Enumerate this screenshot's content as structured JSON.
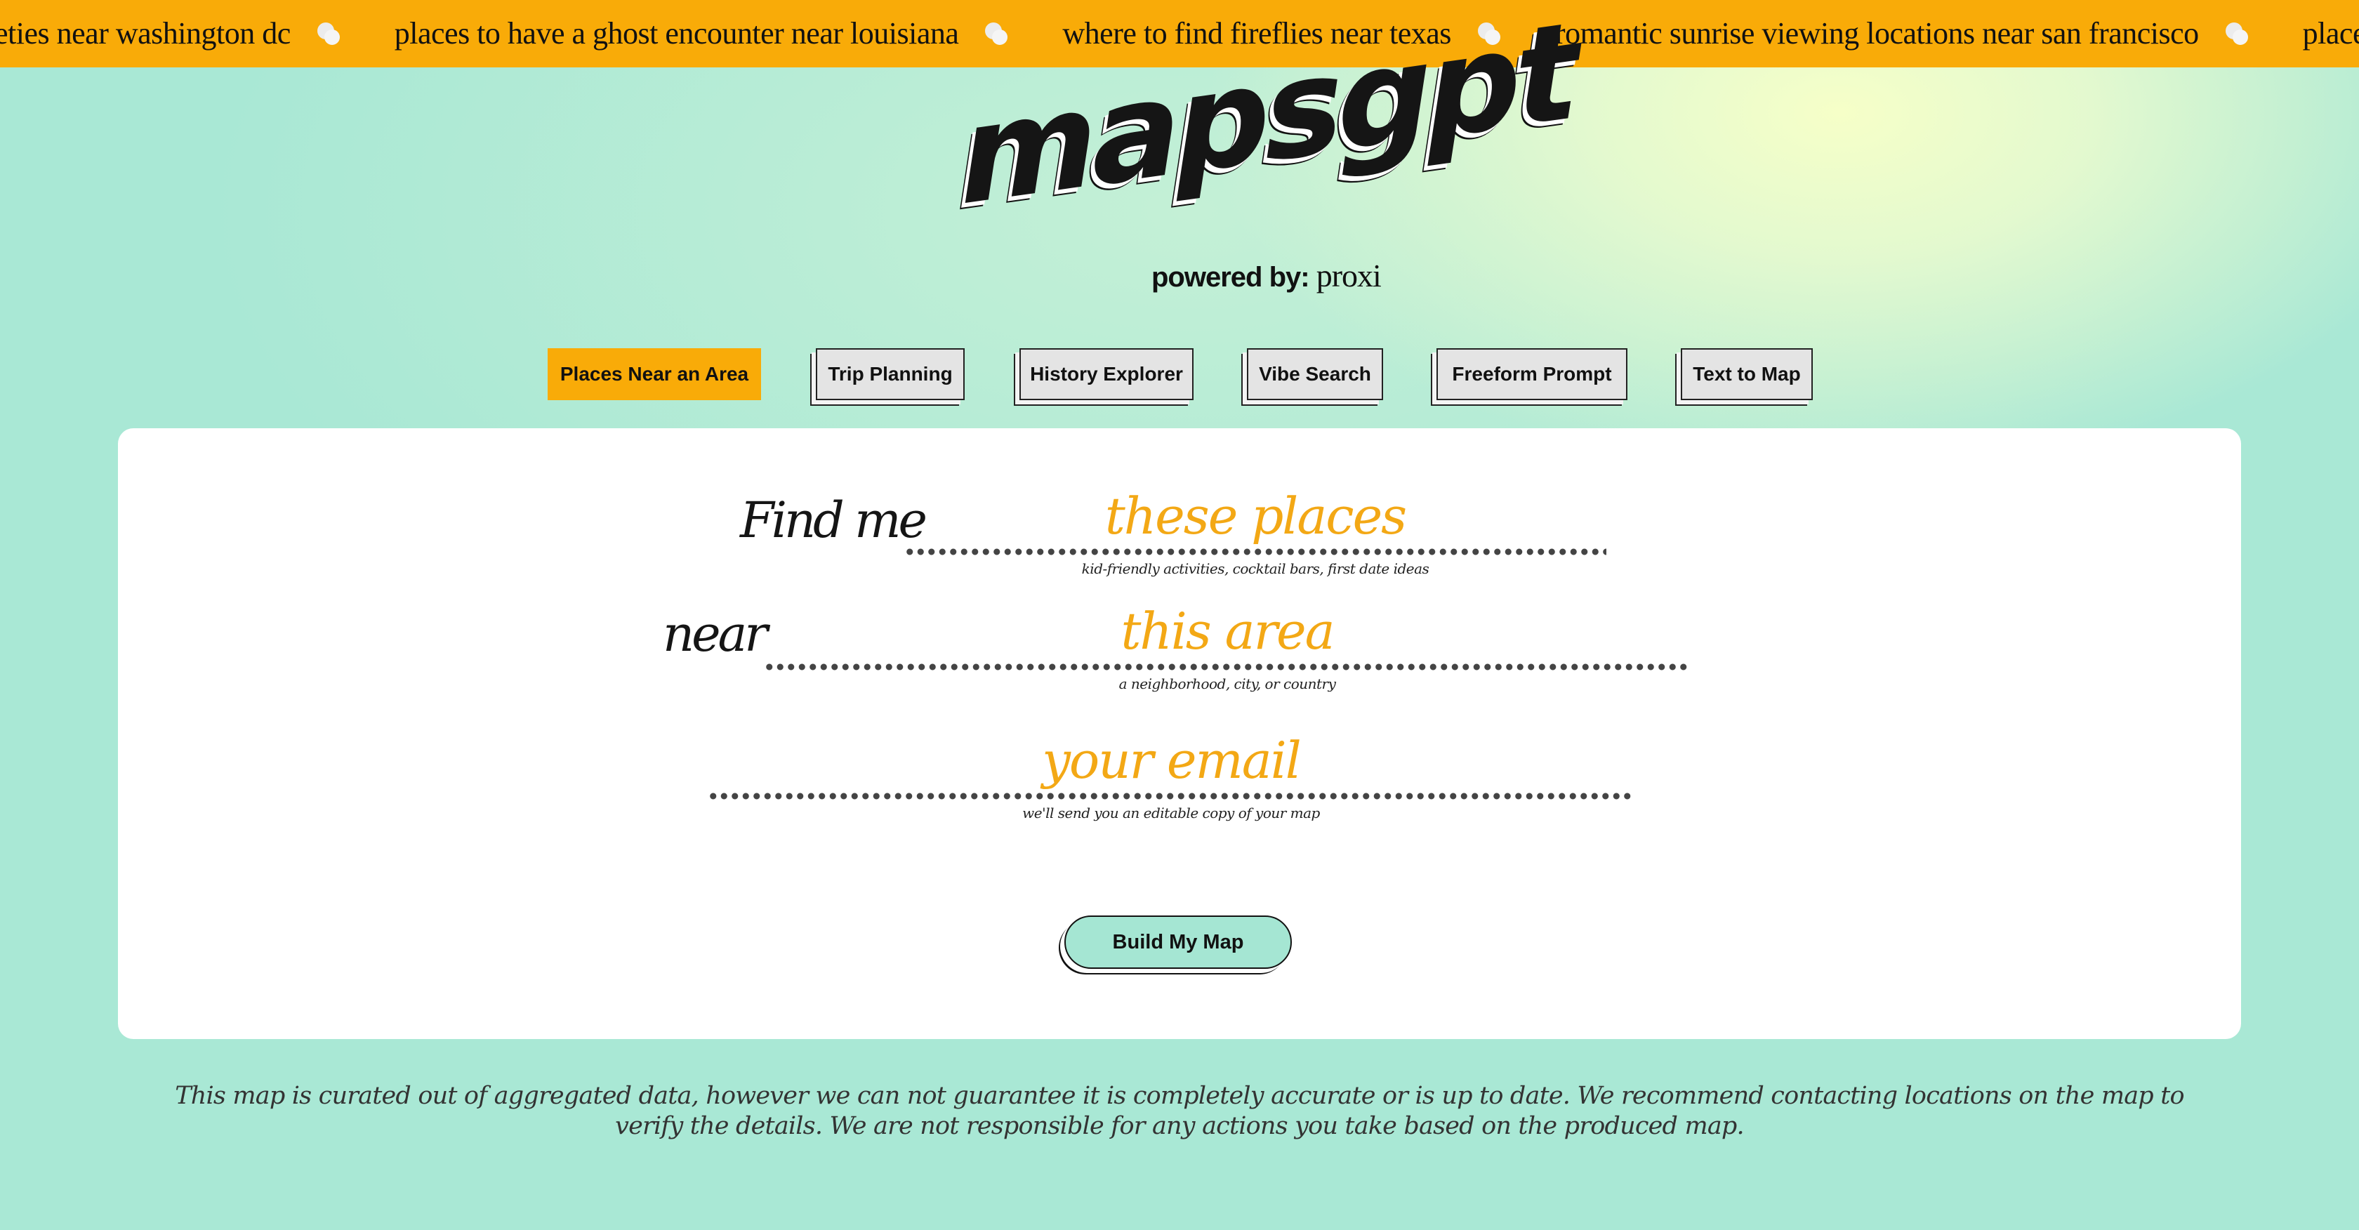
{
  "ticker": {
    "items": [
      "eties near washington dc",
      "places to have a ghost encounter near louisiana",
      "where to find fireflies near texas",
      "romantic sunrise viewing locations near san francisco",
      "places to get my creativ"
    ],
    "separator_icon": "moon-dots-icon"
  },
  "logo": {
    "wordmark": "mapsgpt",
    "powered_by": "powered by:",
    "brand": "proxi"
  },
  "tabs": [
    {
      "label": "Places Near an Area",
      "active": true
    },
    {
      "label": "Trip Planning",
      "active": false
    },
    {
      "label": "History Explorer",
      "active": false
    },
    {
      "label": "Vibe Search",
      "active": false
    },
    {
      "label": "Freeform Prompt",
      "active": false
    },
    {
      "label": "Text to Map",
      "active": false
    }
  ],
  "form": {
    "find_me": "Find me",
    "places": {
      "placeholder": "these places",
      "value": "",
      "hint": "kid-friendly activities, cocktail bars, first date ideas"
    },
    "near": "near",
    "area": {
      "placeholder": "this area",
      "value": "",
      "hint": "a neighborhood, city, or country"
    },
    "email": {
      "placeholder": "your email",
      "value": "",
      "hint": "we'll  send you an editable copy of your map"
    },
    "submit_label": "Build My Map"
  },
  "disclaimer": "This map is curated out of aggregated data, however we can not guarantee it is completely accurate or is up to date. We recommend contacting locations on the map to verify the details. We are not responsible for any actions you take based on the produced map.",
  "colors": {
    "accent": "#f9ab08",
    "background": "#a9e8d5",
    "highlight": "#f6ffc8",
    "button": "#a5e6d3",
    "placeholder": "#f3a815"
  }
}
